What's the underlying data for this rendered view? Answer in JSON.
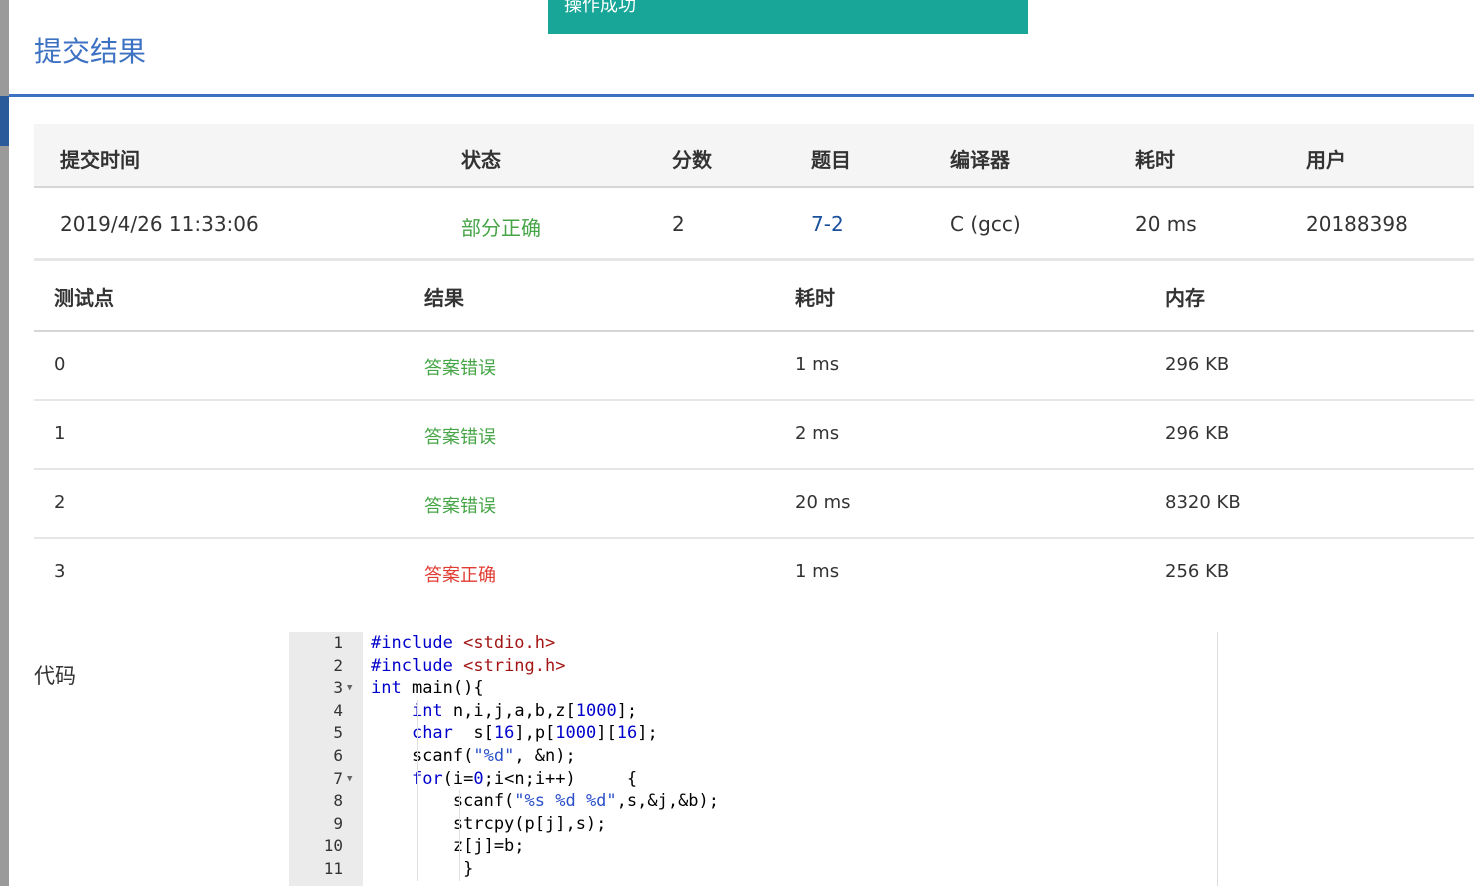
{
  "toast": {
    "message": "操作成功"
  },
  "modal": {
    "title": "提交结果"
  },
  "summary": {
    "headers": [
      "提交时间",
      "状态",
      "分数",
      "题目",
      "编译器",
      "耗时",
      "用户"
    ],
    "row": {
      "time": "2019/4/26 11:33:06",
      "status": "部分正确",
      "score": "2",
      "problem": "7-2",
      "compiler": "C (gcc)",
      "elapsed": "20 ms",
      "user": "20188398"
    }
  },
  "cases": {
    "headers": [
      "测试点",
      "结果",
      "耗时",
      "内存"
    ],
    "rows": [
      {
        "id": "0",
        "result": "答案错误",
        "time": "1 ms",
        "memory": "296 KB"
      },
      {
        "id": "1",
        "result": "答案错误",
        "time": "2 ms",
        "memory": "296 KB"
      },
      {
        "id": "2",
        "result": "答案错误",
        "time": "20 ms",
        "memory": "8320 KB"
      },
      {
        "id": "3",
        "result": "答案正确",
        "time": "1 ms",
        "memory": "256 KB"
      }
    ]
  },
  "code": {
    "label": "代码",
    "lines": [
      "#include <stdio.h>",
      "#include <string.h>",
      "int main(){",
      "    int n,i,j,a,b,z[1000];",
      "    char  s[16],p[1000][16];",
      "    scanf(\"%d\", &n);",
      "    for(i=0;i<n;i++)     {",
      "        scanf(\"%s %d %d\",s,&j,&b);",
      "        strcpy(p[j],s);",
      "        z[j]=b;",
      "         }"
    ],
    "line_numbers": [
      "1",
      "2",
      "3",
      "4",
      "5",
      "6",
      "7",
      "8",
      "9",
      "10",
      "11"
    ]
  },
  "colors": {
    "accent": "#3d72c3",
    "toast": "#17a697",
    "wrong": "#46a546",
    "correct": "#e03c31"
  }
}
